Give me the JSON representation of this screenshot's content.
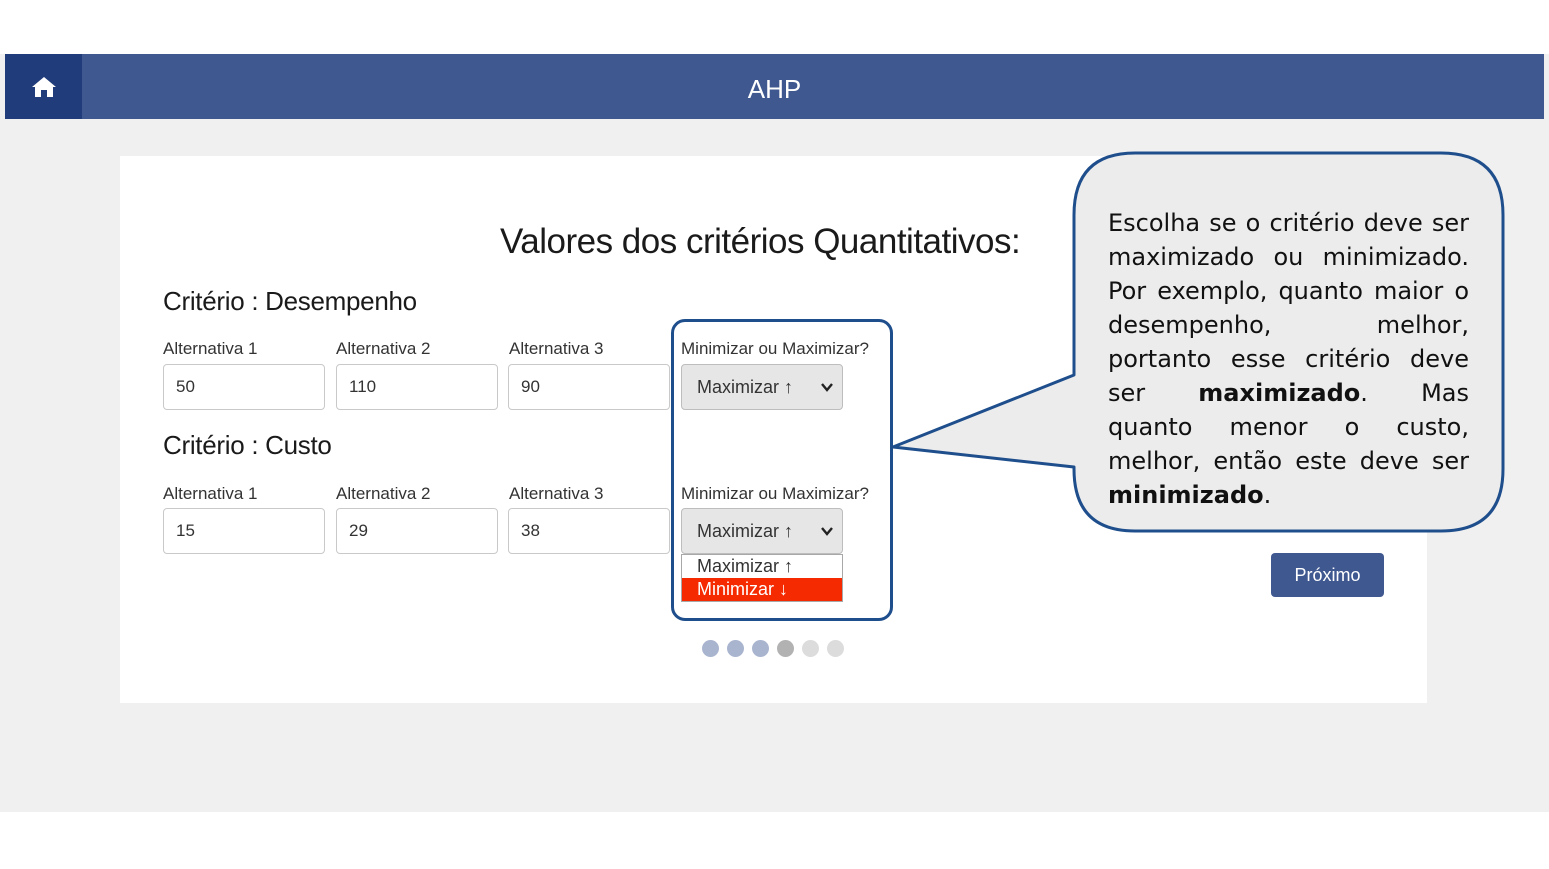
{
  "header": {
    "title": "AHP",
    "home_icon": "home-icon"
  },
  "page": {
    "section_title": "Valores dos critérios Quantitativos:"
  },
  "criteria": [
    {
      "title": "Critério : Desempenho",
      "alternatives": [
        {
          "label": "Alternativa 1",
          "value": "50"
        },
        {
          "label": "Alternativa 2",
          "value": "110"
        },
        {
          "label": "Alternativa 3",
          "value": "90"
        }
      ],
      "direction_label": "Minimizar ou Maximizar?",
      "direction_value": "Maximizar ↑"
    },
    {
      "title": "Critério : Custo",
      "alternatives": [
        {
          "label": "Alternativa 1",
          "value": "15"
        },
        {
          "label": "Alternativa 2",
          "value": "29"
        },
        {
          "label": "Alternativa 3",
          "value": "38"
        }
      ],
      "direction_label": "Minimizar ou Maximizar?",
      "direction_value": "Maximizar ↑",
      "dropdown_open": true,
      "dropdown_options": [
        "Maximizar ↑",
        "Minimizar ↓"
      ],
      "dropdown_highlighted": "Minimizar ↓"
    }
  ],
  "buttons": {
    "next": "Próximo"
  },
  "progress": {
    "total_steps": 6,
    "current_step": 4
  },
  "callout": {
    "text_1": "Escolha se o critério deve ser maximizado ou minimizado. Por exemplo, quanto maior o desempenho, melhor, portanto esse critério deve ser ",
    "bold_1": "maximizado",
    "text_2": ". Mas quanto menor o custo, melhor, então este deve ser ",
    "bold_2": "minimizado",
    "text_3": "."
  },
  "colors": {
    "header_bg": "#3f5890",
    "home_bg": "#213c7a",
    "page_bg": "#f0f0f0",
    "highlight_option": "#f52a00",
    "callout_border": "#1f4e8c",
    "callout_fill": "#ececec"
  }
}
